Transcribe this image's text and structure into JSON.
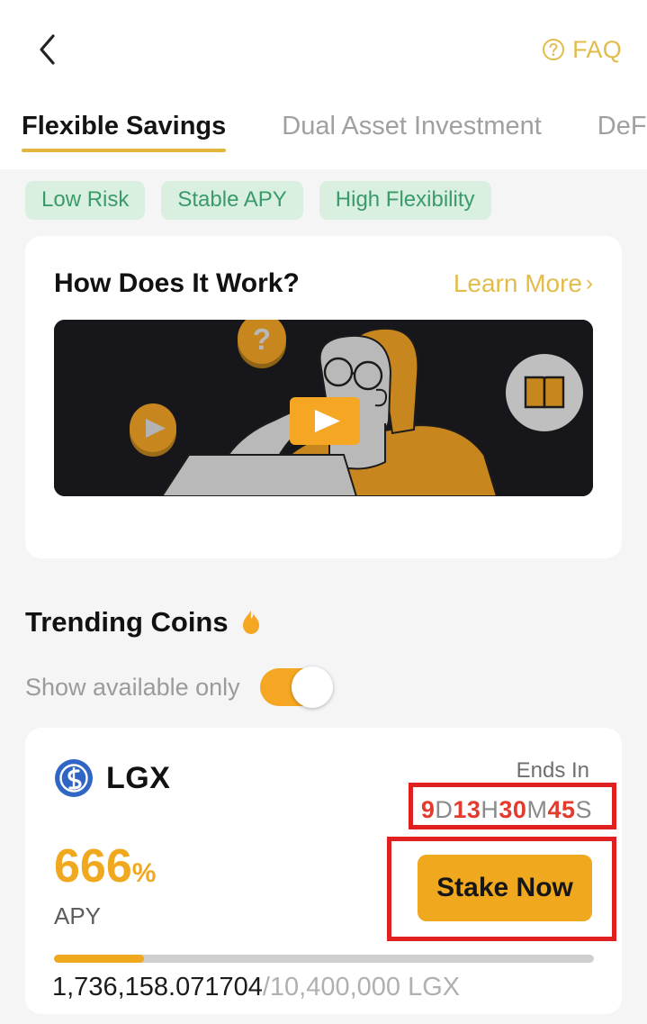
{
  "header": {
    "back_icon": "chevron-left-icon",
    "faq_icon": "question-circle-icon",
    "faq_label": "FAQ"
  },
  "tabs": [
    {
      "label": "Flexible Savings",
      "active": true
    },
    {
      "label": "Dual Asset Investment",
      "active": false
    },
    {
      "label": "DeFi Mining",
      "active": false
    }
  ],
  "pills": [
    {
      "label": "Low Risk"
    },
    {
      "label": "Stable APY"
    },
    {
      "label": "High Flexibility"
    }
  ],
  "how_card": {
    "title": "How Does It Work?",
    "learn_more_label": "Learn More",
    "learn_more_chevron": "›",
    "video_icon": "play-button-icon",
    "video_elements": [
      "coin-play-icon",
      "question-coin-icon",
      "book-icon",
      "person-at-laptop-illustration"
    ]
  },
  "trending": {
    "title": "Trending Coins",
    "flame_icon": "flame-icon",
    "toggle_label": "Show available only",
    "toggle_state": "on"
  },
  "coin_card": {
    "logo_icon": "lgx-coin-icon",
    "name": "LGX",
    "ends_in_label": "Ends In",
    "countdown": {
      "days": "9",
      "days_unit": "D",
      "hours": "13",
      "hours_unit": "H",
      "minutes": "30",
      "minutes_unit": "M",
      "seconds": "45",
      "seconds_unit": "S"
    },
    "apy_value": "666",
    "apy_percent": "%",
    "apy_label": "APY",
    "stake_button_label": "Stake Now",
    "progress_percent": 16.7,
    "amount_current": "1,736,158.071704",
    "amount_total": "/10,400,000 LGX"
  },
  "colors": {
    "accent": "#f0a81f",
    "gold_text": "#e2bc4b",
    "pill_bg": "#d9f0e0",
    "pill_text": "#3a9a6a",
    "countdown_number": "#e33b2e",
    "annotation": "#e02020",
    "page_bg": "#f5f5f5"
  }
}
